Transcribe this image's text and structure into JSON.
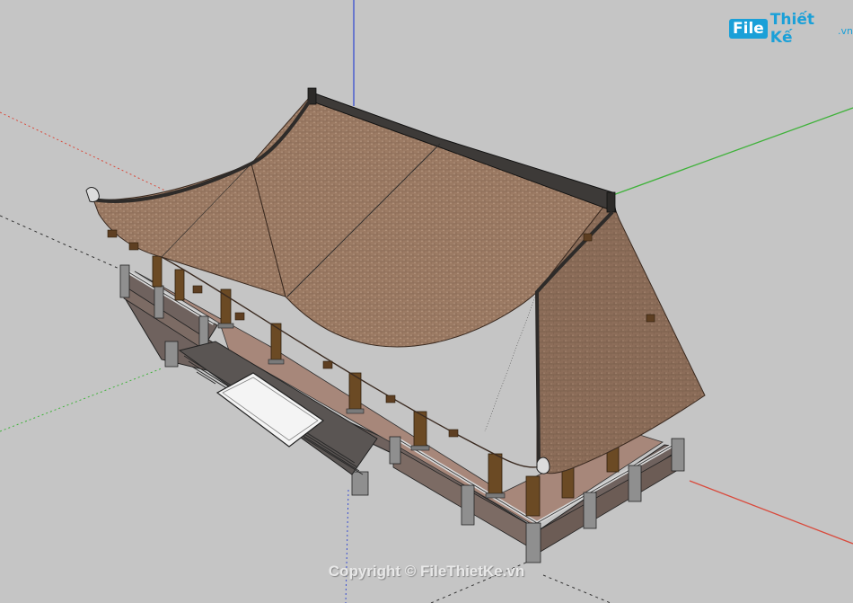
{
  "logo": {
    "box": "File",
    "text": "Thiết Kế",
    "suffix": ".vn",
    "color": "#1aa0d8"
  },
  "copyright": "Copyright © FileThietKe.vn",
  "colors": {
    "background": "#c5c5c5",
    "roof": "#9b7a63",
    "roof_dark": "#7e604c",
    "ridge": "#3d3a38",
    "column": "#6b4a24",
    "floor": "#a7877a",
    "wall": "#7c6b64",
    "axis_red": "#d94a3c",
    "axis_green": "#3fb23a",
    "axis_blue": "#3a4fd0"
  }
}
